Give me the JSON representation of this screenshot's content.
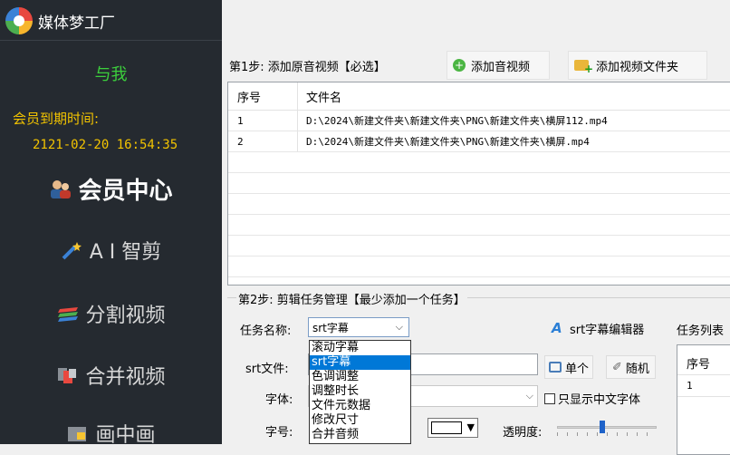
{
  "sidebar": {
    "app_name": "媒体梦工厂",
    "user_name": "与我",
    "expire_label": "会员到期时间:",
    "expire_value": "2121-02-20 16:54:35",
    "nav": {
      "vip": "会员中心",
      "ai": "A I 智剪",
      "split": "分割视频",
      "merge": "合并视频",
      "pip": "画中画"
    }
  },
  "step1": {
    "label": "第1步: 添加原音视频【必选】",
    "add_av": "添加音视频",
    "add_folder": "添加视频文件夹",
    "table": {
      "headers": [
        "序号",
        "文件名"
      ],
      "rows": [
        {
          "no": "1",
          "name": "D:\\2024\\新建文件夹\\新建文件夹\\PNG\\新建文件夹\\横屏112.mp4"
        },
        {
          "no": "2",
          "name": "D:\\2024\\新建文件夹\\新建文件夹\\PNG\\新建文件夹\\横屏.mp4"
        }
      ]
    }
  },
  "step2": {
    "label": "第2步: 剪辑任务管理【最少添加一个任务】",
    "task_name_label": "任务名称:",
    "task_selected": "srt字幕",
    "task_options": [
      "滚动字幕",
      "srt字幕",
      "色调调整",
      "调整时长",
      "文件元数据",
      "修改尺寸",
      "合并音频"
    ],
    "editor_btn": "srt字幕编辑器",
    "task_list_label": "任务列表",
    "task_list_header": "序号",
    "task_list_row": "1",
    "srt_label": "srt文件:",
    "single_btn": "单个",
    "random_btn": "随机",
    "font_label": "字体:",
    "cn_only": "只显示中文字体",
    "size_label": "字号:",
    "opacity_label": "透明度:",
    "opacity_value": 0.45,
    "font_color": "#ffffff"
  },
  "colors": {
    "sidebar_bg": "#252a30",
    "accent_green": "#3ccf3c",
    "accent_yellow": "#f2c300",
    "selection_blue": "#0078d7"
  }
}
